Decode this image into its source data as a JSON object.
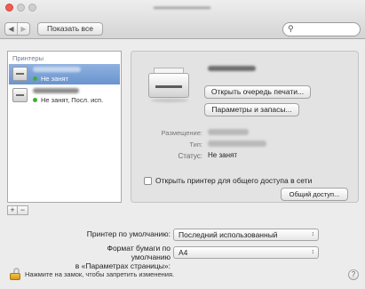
{
  "toolbar": {
    "back": "◀",
    "forward": "▶",
    "show_all": "Показать все",
    "search": {
      "value": "",
      "placeholder": ""
    }
  },
  "sidebar": {
    "header": "Принтеры",
    "printers": [
      {
        "status": "Не занят",
        "selected": true
      },
      {
        "status": "Не занят, Посл. исп.",
        "selected": false
      }
    ],
    "add_label": "+",
    "remove_label": "−"
  },
  "details": {
    "open_queue_button": "Открыть очередь печати...",
    "options_button": "Параметры и запасы...",
    "location_label": "Размещение:",
    "type_label": "Тип:",
    "status_label": "Статус:",
    "status_value": "Не занят",
    "share_label": "Открыть принтер для общего доступа в сети",
    "share_checked": false,
    "sharing_button": "Общий доступ..."
  },
  "defaults": {
    "printer_label": "Принтер по умолчанию:",
    "printer_value": "Последний использованный",
    "paper_label_line1": "Формат бумаги по умолчанию",
    "paper_label_line2": "в «Параметрах страницы»:",
    "paper_value": "A4"
  },
  "footer": {
    "lock_text": "Нажмите на замок, чтобы запретить изменения.",
    "help_label": "?"
  },
  "colors": {
    "selection": "#7aa0d6",
    "status_dot": "#3fae36",
    "close": "#f05b55"
  }
}
